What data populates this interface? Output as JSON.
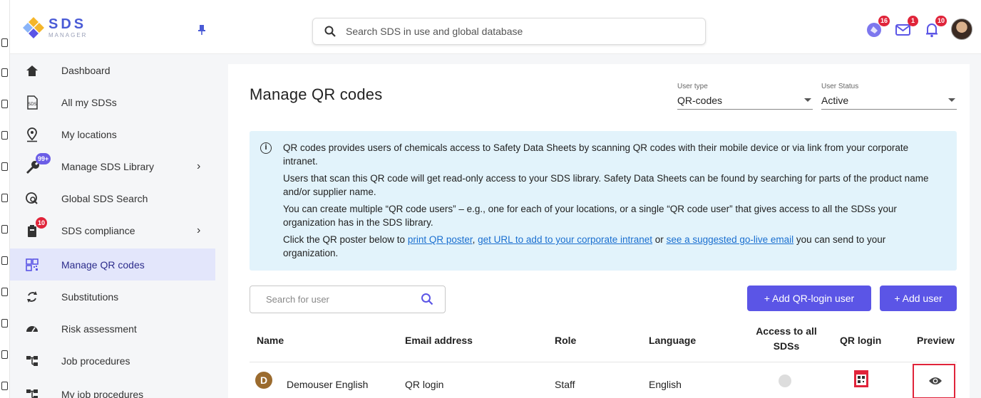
{
  "app": {
    "logo_text": "SDS",
    "logo_subtext": "MANAGER"
  },
  "search": {
    "placeholder": "Search SDS in use and global database"
  },
  "top_icons": [
    {
      "name": "sds-request-icon",
      "badge": "16"
    },
    {
      "name": "mail-icon",
      "badge": "1"
    },
    {
      "name": "bell-icon",
      "badge": "10"
    }
  ],
  "sidebar": {
    "items": [
      {
        "label": "Dashboard",
        "icon": "home-icon"
      },
      {
        "label": "All my SDSs",
        "icon": "sds-document-icon"
      },
      {
        "label": "My locations",
        "icon": "location-pin-icon"
      },
      {
        "label": "Manage SDS Library",
        "icon": "wrench-icon",
        "badge": "99+",
        "has_chevron": true
      },
      {
        "label": "Global SDS Search",
        "icon": "globe-search-icon"
      },
      {
        "label": "SDS compliance",
        "icon": "clipboard-icon",
        "badge": "10",
        "has_chevron": true
      },
      {
        "label": "Manage QR codes",
        "icon": "qr-code-icon",
        "active": true
      },
      {
        "label": "Substitutions",
        "icon": "swap-icon"
      },
      {
        "label": "Risk assessment",
        "icon": "gauge-icon"
      },
      {
        "label": "Job procedures",
        "icon": "hierarchy-icon"
      },
      {
        "label": "My job procedures",
        "icon": "hierarchy-icon"
      }
    ]
  },
  "page": {
    "title": "Manage QR codes"
  },
  "filters": {
    "user_type": {
      "label": "User type",
      "value": "QR-codes"
    },
    "user_status": {
      "label": "User Status",
      "value": "Active"
    }
  },
  "info": {
    "p1": "QR codes provides users of chemicals access to Safety Data Sheets by scanning QR codes with their mobile device or via link from your corporate intranet.",
    "p2": "Users that scan this QR code will get read-only access to your SDS library. Safety Data Sheets can be found by searching for parts of the product name and/or supplier name.",
    "p3": "You can create multiple “QR code users” – e.g., one for each of your locations, or a single “QR code user” that gives access to all the SDSs your organization has in the SDS library.",
    "p4_pre": "Click the QR poster below to ",
    "link1": "print QR poster",
    "sep1": ", ",
    "link2": "get URL to add to your corporate intranet",
    "sep2": " or ",
    "link3": "see a suggested go-live email",
    "p4_post": " you can send to your organization."
  },
  "user_search": {
    "placeholder": "Search for user"
  },
  "buttons": {
    "add_qr_login_user": "+ Add QR-login user",
    "add_user": "+ Add user"
  },
  "table": {
    "headers": {
      "name": "Name",
      "email": "Email address",
      "role": "Role",
      "language": "Language",
      "access_line1": "Access to all",
      "access_line2": "SDSs",
      "qr_login": "QR login",
      "preview": "Preview"
    },
    "rows": [
      {
        "avatar_letter": "D",
        "name": "Demouser English",
        "email": "QR login",
        "role": "Staff",
        "language": "English",
        "access_all": false
      }
    ]
  },
  "colors": {
    "accent": "#5b55e6",
    "active_nav_bg": "#e3e6fb",
    "info_bg": "#e2f3fb",
    "badge": "#e0243a",
    "highlight_border": "#e0243a"
  }
}
